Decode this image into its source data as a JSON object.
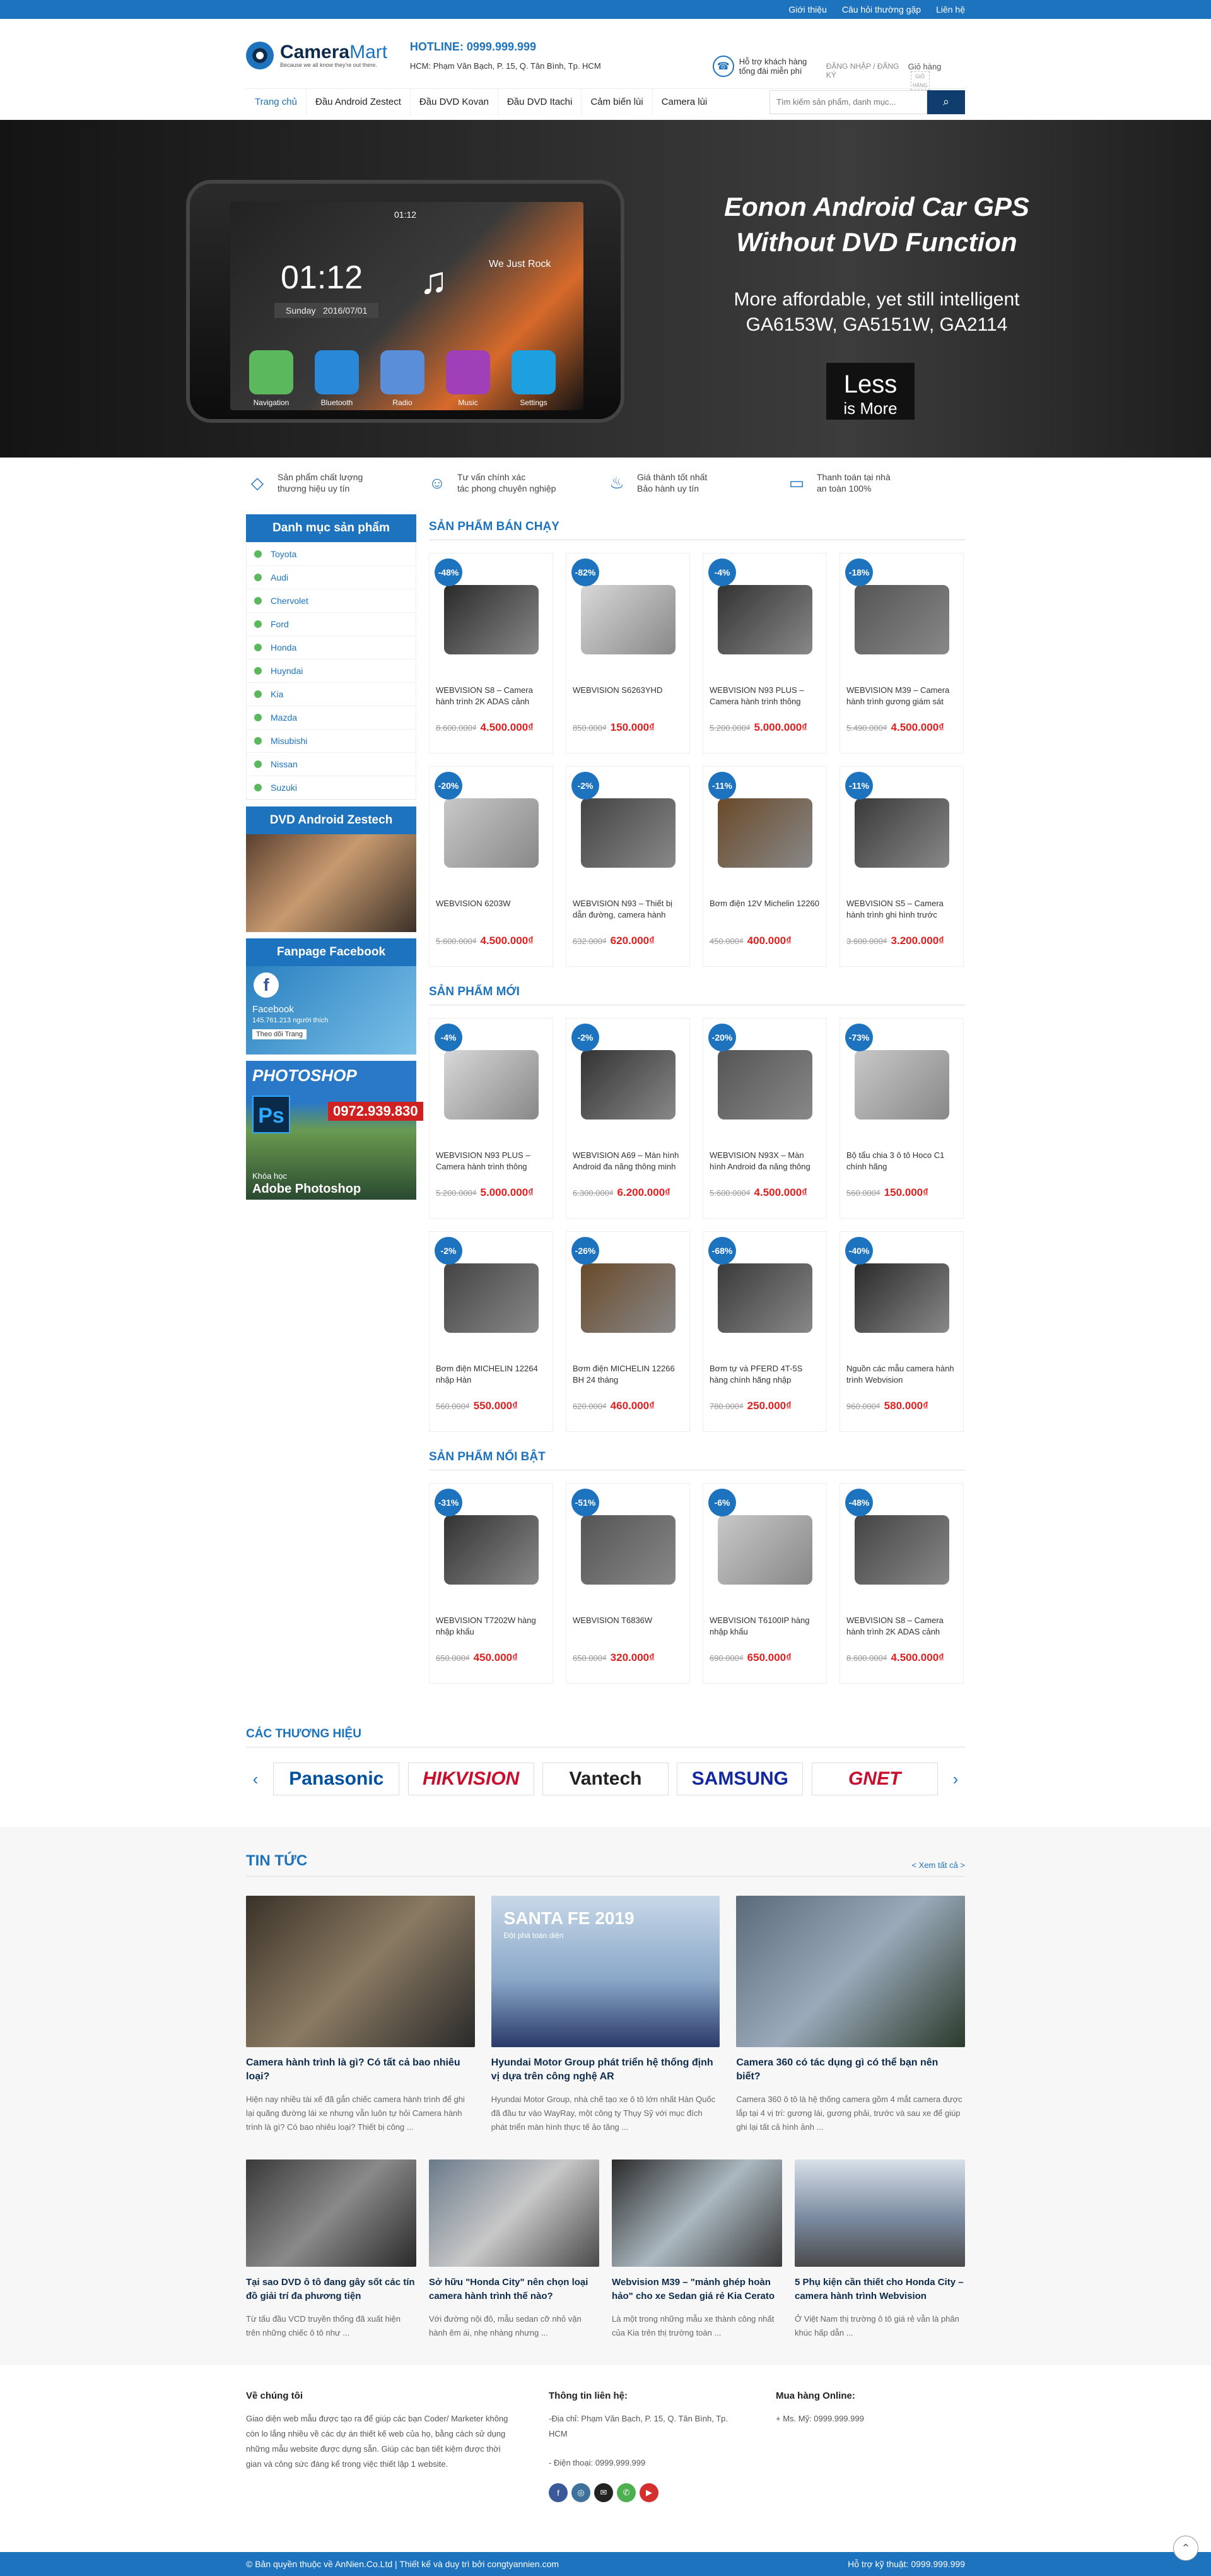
{
  "topbar": {
    "links": [
      "Giới thiệu",
      "Câu hỏi thường gặp",
      "Liên hệ"
    ]
  },
  "header": {
    "logo_main": "Camera",
    "logo_accent": "Mart",
    "logo_tagline": "Because we all know they're out there.",
    "hotline": "HOTLINE: 0999.999.999",
    "address": "HCM: Phạm Văn Bạch, P. 15, Q. Tân Bình, Tp. HCM",
    "support_line1": "Hỗ trợ khách hàng",
    "support_line2": "tổng đài miễn phí",
    "account": "ĐĂNG NHẬP / ĐĂNG KÝ",
    "cart": "Giỏ hàng",
    "cart_img_alt": "GIỎ HÀNG"
  },
  "nav": {
    "items": [
      "Trang chủ",
      "Đầu Android Zestect",
      "Đầu DVD Kovan",
      "Đầu DVD Itachi",
      "Cảm biến lùi",
      "Camera lùi"
    ],
    "search_placeholder": "Tìm kiếm sản phẩm, danh mục...",
    "search_icon": "search-icon"
  },
  "banner": {
    "time": "01:12",
    "clock": "01:12",
    "day": "Sunday",
    "date": "2016/07/01",
    "song": "We Just Rock",
    "apps": [
      "Navigation",
      "Bluetooth",
      "Radio",
      "Music",
      "Settings"
    ],
    "title_line1": "Eonon Android Car GPS",
    "title_line2": "Without DVD Function",
    "sub_line1": "More affordable, yet still intelligent",
    "sub_line2": "GA6153W, GA5151W, GA2114",
    "badge1": "Less",
    "badge2": "is More"
  },
  "features": [
    {
      "l1": "Sản phẩm chất lượng",
      "l2": "thương hiệu uy tín",
      "icon": "diamond-icon"
    },
    {
      "l1": "Tư vấn chính xác",
      "l2": "tác phong chuyên nghiệp",
      "icon": "consultant-icon"
    },
    {
      "l1": "Giá thành tốt nhất",
      "l2": "Bảo hành uy tín",
      "icon": "flame-icon"
    },
    {
      "l1": "Thanh toán tại nhà",
      "l2": "an toàn 100%",
      "icon": "wallet-icon"
    }
  ],
  "sidebar": {
    "cat_title": "Danh mục sản phẩm",
    "categories": [
      "Toyota",
      "Audi",
      "Chervolet",
      "Ford",
      "Honda",
      "Huyndai",
      "Kia",
      "Mazda",
      "Misubishi",
      "Nissan",
      "Suzuki"
    ],
    "box1_title": "DVD Android Zestech",
    "box2_title": "Fanpage Facebook",
    "fb_name": "Facebook",
    "fb_likes": "145.761.213 người thích",
    "fb_follow": "Theo dõi Trang",
    "ps_title": "PHOTOSHOP",
    "ps_phone": "0972.939.830",
    "ps_course": "Khóa học",
    "ps_name": "Adobe Photoshop"
  },
  "sections": [
    {
      "title": "SẢN PHẨM BÁN CHẠY",
      "products": [
        {
          "disc": "-48%",
          "name": "WEBVISION S8 – Camera hành trình 2K ADAS cảnh",
          "old": "8.600.000₫",
          "new": "4.500.000₫"
        },
        {
          "disc": "-82%",
          "name": "WEBVISION S6263YHD",
          "old": "850.000₫",
          "new": "150.000₫"
        },
        {
          "disc": "-4%",
          "name": "WEBVISION N93 PLUS – Camera hành trình thông",
          "old": "5.200.000₫",
          "new": "5.000.000₫"
        },
        {
          "disc": "-18%",
          "name": "WEBVISION M39 – Camera hành trình gương giám sát",
          "old": "5.490.000₫",
          "new": "4.500.000₫"
        },
        {
          "disc": "-20%",
          "name": "WEBVISION 6203W",
          "old": "5.600.000₫",
          "new": "4.500.000₫"
        },
        {
          "disc": "-2%",
          "name": "WEBVISION N93 – Thiết bị dẫn đường, camera hành",
          "old": "632.000₫",
          "new": "620.000₫"
        },
        {
          "disc": "-11%",
          "name": "Bơm điện 12V Michelin 12260",
          "old": "450.000₫",
          "new": "400.000₫"
        },
        {
          "disc": "-11%",
          "name": "WEBVISION S5 – Camera hành trình ghi hình trước",
          "old": "3.600.000₫",
          "new": "3.200.000₫"
        }
      ]
    },
    {
      "title": "SẢN PHẨM MỚI",
      "products": [
        {
          "disc": "-4%",
          "name": "WEBVISION N93 PLUS – Camera hành trình thông",
          "old": "5.200.000₫",
          "new": "5.000.000₫"
        },
        {
          "disc": "-2%",
          "name": "WEBVISION A69 – Màn hình Android đa năng thông minh",
          "old": "6.300.000₫",
          "new": "6.200.000₫"
        },
        {
          "disc": "-20%",
          "name": "WEBVISION N93X – Màn hình Android đa năng thông",
          "old": "5.600.000₫",
          "new": "4.500.000₫"
        },
        {
          "disc": "-73%",
          "name": "Bộ tẩu chia 3 ô tô Hoco C1 chính hãng",
          "old": "560.000₫",
          "new": "150.000₫"
        },
        {
          "disc": "-2%",
          "name": "Bơm điện MICHELIN 12264 nhập Hàn",
          "old": "560.000₫",
          "new": "550.000₫"
        },
        {
          "disc": "-26%",
          "name": "Bơm điện MICHELIN 12266 BH 24 tháng",
          "old": "620.000₫",
          "new": "460.000₫"
        },
        {
          "disc": "-68%",
          "name": "Bơm tự và PFERD 4T-5S hàng chính hãng nhập",
          "old": "780.000₫",
          "new": "250.000₫"
        },
        {
          "disc": "-40%",
          "name": "Nguồn các mẫu camera hành trình Webvision",
          "old": "960.000₫",
          "new": "580.000₫"
        }
      ]
    },
    {
      "title": "SẢN PHẨM NỔI BẬT",
      "products": [
        {
          "disc": "-31%",
          "name": "WEBVISION T7202W hàng nhập khẩu",
          "old": "650.000₫",
          "new": "450.000₫"
        },
        {
          "disc": "-51%",
          "name": "WEBVISION T6836W",
          "old": "650.000₫",
          "new": "320.000₫"
        },
        {
          "disc": "-6%",
          "name": "WEBVISION T6100IP hàng nhập khẩu",
          "old": "690.000₫",
          "new": "650.000₫"
        },
        {
          "disc": "-48%",
          "name": "WEBVISION S8 – Camera hành trình 2K ADAS cảnh",
          "old": "8.600.000₫",
          "new": "4.500.000₫"
        }
      ]
    }
  ],
  "brands": {
    "title": "CÁC THƯƠNG HIỆU",
    "items": [
      "Panasonic",
      "HIKVISION",
      "Vantech",
      "SAMSUNG",
      "GNET"
    ],
    "brand_colors": [
      "#0050a0",
      "#c8102e",
      "#222222",
      "#1428a0",
      "#c8102e"
    ]
  },
  "news": {
    "title": "TIN TỨC",
    "more": "< Xem tất cả >",
    "big": [
      {
        "title": "Camera hành trình là gì? Có tất cả bao nhiêu loại?",
        "desc": "Hiện nay nhiều tài xế đã gắn chiếc camera hành trình để ghi lại quãng đường lái xe nhưng vẫn luôn tự hỏi Camera hành trình là gì? Có bao nhiêu loại? Thiết bị công ..."
      },
      {
        "title": "Hyundai Motor Group phát triển hệ thống định vị dựa trên công nghệ AR",
        "desc": "Hyundai Motor Group, nhà chế tạo xe ô tô lớn nhất Hàn Quốc đã đầu tư vào WayRay, một công ty Thụy Sỹ với mục đích phát triển màn hình thực tế ảo tăng ...",
        "img_text1": "SANTA FE 2019",
        "img_text2": "Đột phá toàn diện"
      },
      {
        "title": "Camera 360 có tác dụng gì có thể bạn nên biết?",
        "desc": "Camera 360 ô tô là hệ thống camera gồm 4 mắt camera được lắp tại 4 vị trí: gương lái, gương phải, trước và sau xe để giúp ghi lại tất cả hình ảnh ..."
      }
    ],
    "small": [
      {
        "title": "Tại sao DVD ô tô đang gây sốt các tín đồ giải trí đa phương tiện",
        "desc": "Từ tấu đầu VCD truyền thống đã xuất hiện trên những chiếc ô tô như ..."
      },
      {
        "title": "Sở hữu \"Honda City\" nên chọn loại camera hành trình thế nào?",
        "desc": "Với đường nội đô, mẫu sedan cỡ nhỏ vận hành êm ái, nhẹ nhàng nhưng ..."
      },
      {
        "title": "Webvision M39 – \"mảnh ghép hoàn hảo\" cho xe Sedan giá rẻ Kia Cerato",
        "desc": "Là một trong những mẫu xe thành công nhất của Kia trên thị trường toàn ..."
      },
      {
        "title": "5 Phụ kiện cần thiết cho Honda City – camera hành trình Webvision",
        "desc": "Ở Việt Nam thị trường ô tô giá rẻ vẫn là phân khúc hấp dẫn ..."
      }
    ]
  },
  "footer": {
    "about_title": "Về chúng tôi",
    "about_text": "Giao diện web mẫu được tạo ra để giúp các bạn Coder/ Marketer không còn lo lắng nhiều về các dự án thiết kế web của họ, bằng cách sử dụng những mẫu website được dựng sẵn. Giúp các bạn tiết kiệm được thời gian và công sức đáng kể trong việc thiết lập 1 website.",
    "contact_title": "Thông tin liên hệ:",
    "contact_addr": "-Địa chỉ: Phạm Văn Bạch, P. 15, Q. Tân Bình, Tp. HCM",
    "contact_phone": "- Điện thoại: 0999.999.999",
    "online_title": "Mua hàng Online:",
    "online_text": "+ Ms. Mỹ: 0999.999.999",
    "copyright": "© Bản quyền thuộc về AnNien.Co.Ltd | Thiết kế và duy trì bởi congtyannien.com",
    "support": "Hỗ trợ kỹ thuật: 0999.999.999"
  }
}
